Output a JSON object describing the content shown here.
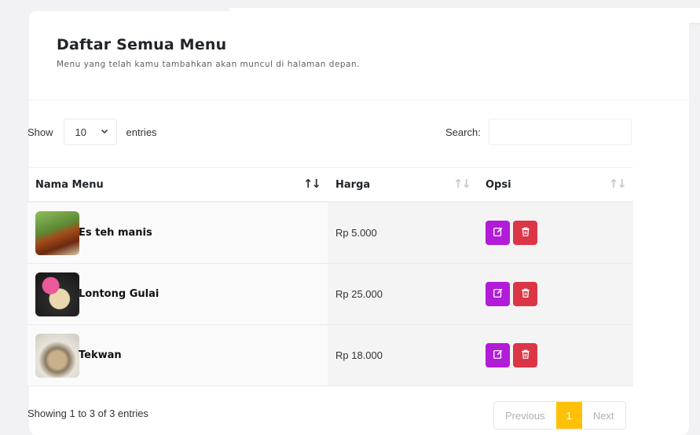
{
  "header": {
    "title": "Daftar Semua Menu",
    "subtitle": "Menu yang telah kamu tambahkan akan muncul di halaman depan."
  },
  "controls": {
    "show_label": "Show",
    "entries_value": "10",
    "entries_label": "entries",
    "search_label": "Search:",
    "search_value": ""
  },
  "table": {
    "columns": [
      "Nama Menu",
      "Harga",
      "Opsi"
    ],
    "sort_icon": "↑↓",
    "rows": [
      {
        "name": "Es teh manis",
        "price": "Rp 5.000",
        "image": "iced-tea-photo"
      },
      {
        "name": "Lontong Gulai",
        "price": "Rp 25.000",
        "image": "lontong-gulai-photo"
      },
      {
        "name": "Tekwan",
        "price": "Rp 18.000",
        "image": "tekwan-photo"
      }
    ]
  },
  "footer": {
    "info": "Showing 1 to 3 of 3 entries",
    "previous": "Previous",
    "current_page": "1",
    "next": "Next"
  },
  "icons": {
    "edit": "pencil-square-icon",
    "delete": "trash-icon",
    "select": "chevron-down-icon",
    "sort": "sort-arrows-icon"
  },
  "colors": {
    "edit_button": "#b21cd9",
    "delete_button": "#dc3545",
    "active_page": "#ffc107"
  }
}
